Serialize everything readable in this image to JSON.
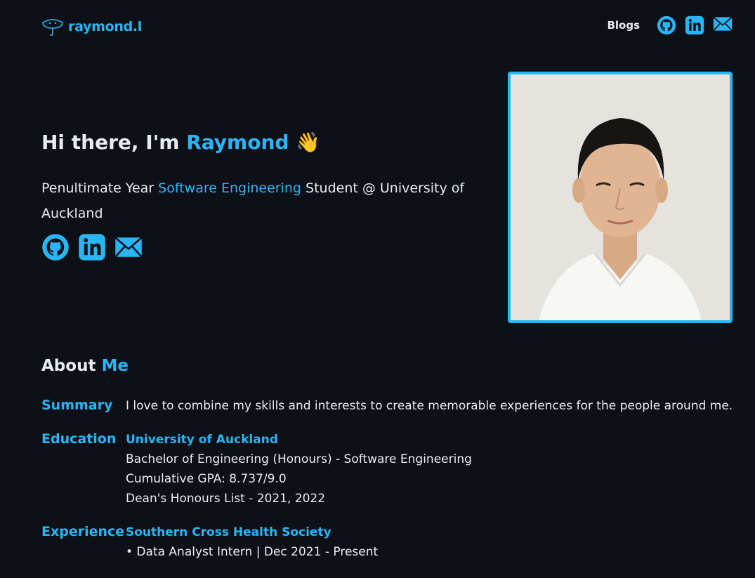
{
  "header": {
    "logo_text": "raymond.l",
    "nav_blogs": "Blogs"
  },
  "hero": {
    "greeting": "Hi there, I'm",
    "name": "Raymond",
    "wave": "👋",
    "sub_prefix": "Penultimate Year",
    "sub_highlight": "Software Engineering",
    "sub_suffix": "Student @ University of Auckland"
  },
  "about": {
    "title_a": "About",
    "title_b": "Me",
    "summary_label": "Summary",
    "summary_text": "I love to combine my skills and interests to create memorable experiences for the people around me.",
    "education_label": "Education",
    "education": {
      "school": "University of Auckland",
      "degree": "Bachelor of Engineering (Honours) - Software Engineering",
      "gpa": "Cumulative GPA: 8.737/9.0",
      "honours": "Dean's Honours List - 2021, 2022"
    },
    "experience_label": "Experience",
    "experience": {
      "org": "Southern Cross Health Society",
      "role": "• Data Analyst Intern | Dec 2021 - Present"
    }
  },
  "colors": {
    "background": "#0d1117",
    "accent": "#29b6f6",
    "text": "#e6edf3"
  },
  "icons": [
    "logo-icon",
    "github-icon",
    "linkedin-icon",
    "email-icon"
  ]
}
